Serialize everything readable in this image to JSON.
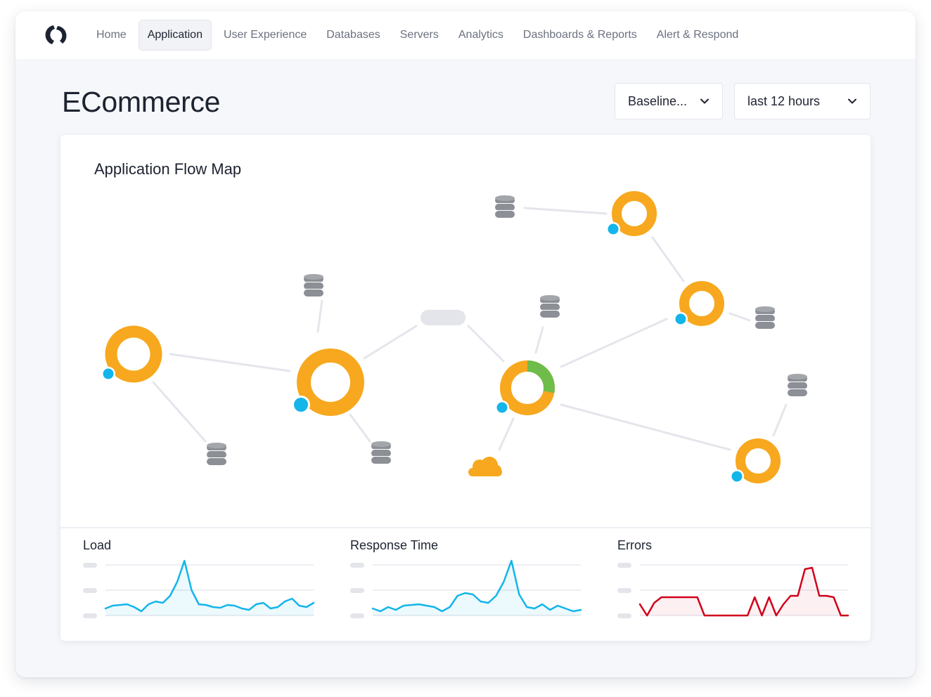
{
  "nav": {
    "items": [
      {
        "label": "Home",
        "active": false
      },
      {
        "label": "Application",
        "active": true
      },
      {
        "label": "User Experience",
        "active": false
      },
      {
        "label": "Databases",
        "active": false
      },
      {
        "label": "Servers",
        "active": false
      },
      {
        "label": "Analytics",
        "active": false
      },
      {
        "label": "Dashboards & Reports",
        "active": false
      },
      {
        "label": "Alert & Respond",
        "active": false
      }
    ]
  },
  "page": {
    "title": "ECommerce",
    "baseline_dropdown": "Baseline...",
    "time_dropdown": "last 12 hours"
  },
  "flow_map": {
    "title": "Application Flow Map",
    "colors": {
      "tier": "#f7a81e",
      "healthy": "#6ebc4a",
      "agent_dot": "#13b5ea",
      "database": "#8c8f95",
      "cloud": "#f7a81e",
      "edge": "#e4e6ec",
      "pill": "#e3e5ea"
    },
    "nodes": [
      {
        "name": "tier-node-1",
        "kind": "tier"
      },
      {
        "name": "tier-node-2",
        "kind": "tier"
      },
      {
        "name": "tier-node-3",
        "kind": "tier",
        "healthy_fraction": 0.28
      },
      {
        "name": "tier-node-4",
        "kind": "tier"
      },
      {
        "name": "tier-node-5",
        "kind": "tier"
      },
      {
        "name": "tier-node-6",
        "kind": "tier"
      },
      {
        "name": "database-1",
        "kind": "database"
      },
      {
        "name": "database-2",
        "kind": "database"
      },
      {
        "name": "database-3",
        "kind": "database"
      },
      {
        "name": "database-4",
        "kind": "database"
      },
      {
        "name": "database-5",
        "kind": "database"
      },
      {
        "name": "database-6",
        "kind": "database"
      },
      {
        "name": "database-7",
        "kind": "database"
      },
      {
        "name": "cloud-service",
        "kind": "cloud"
      },
      {
        "name": "service-pill",
        "kind": "pill"
      }
    ]
  },
  "metrics": {
    "load": {
      "title": "Load",
      "color": "#13b5ea"
    },
    "response_time": {
      "title": "Response Time",
      "color": "#13b5ea"
    },
    "errors": {
      "title": "Errors",
      "color": "#d0021b"
    }
  }
}
